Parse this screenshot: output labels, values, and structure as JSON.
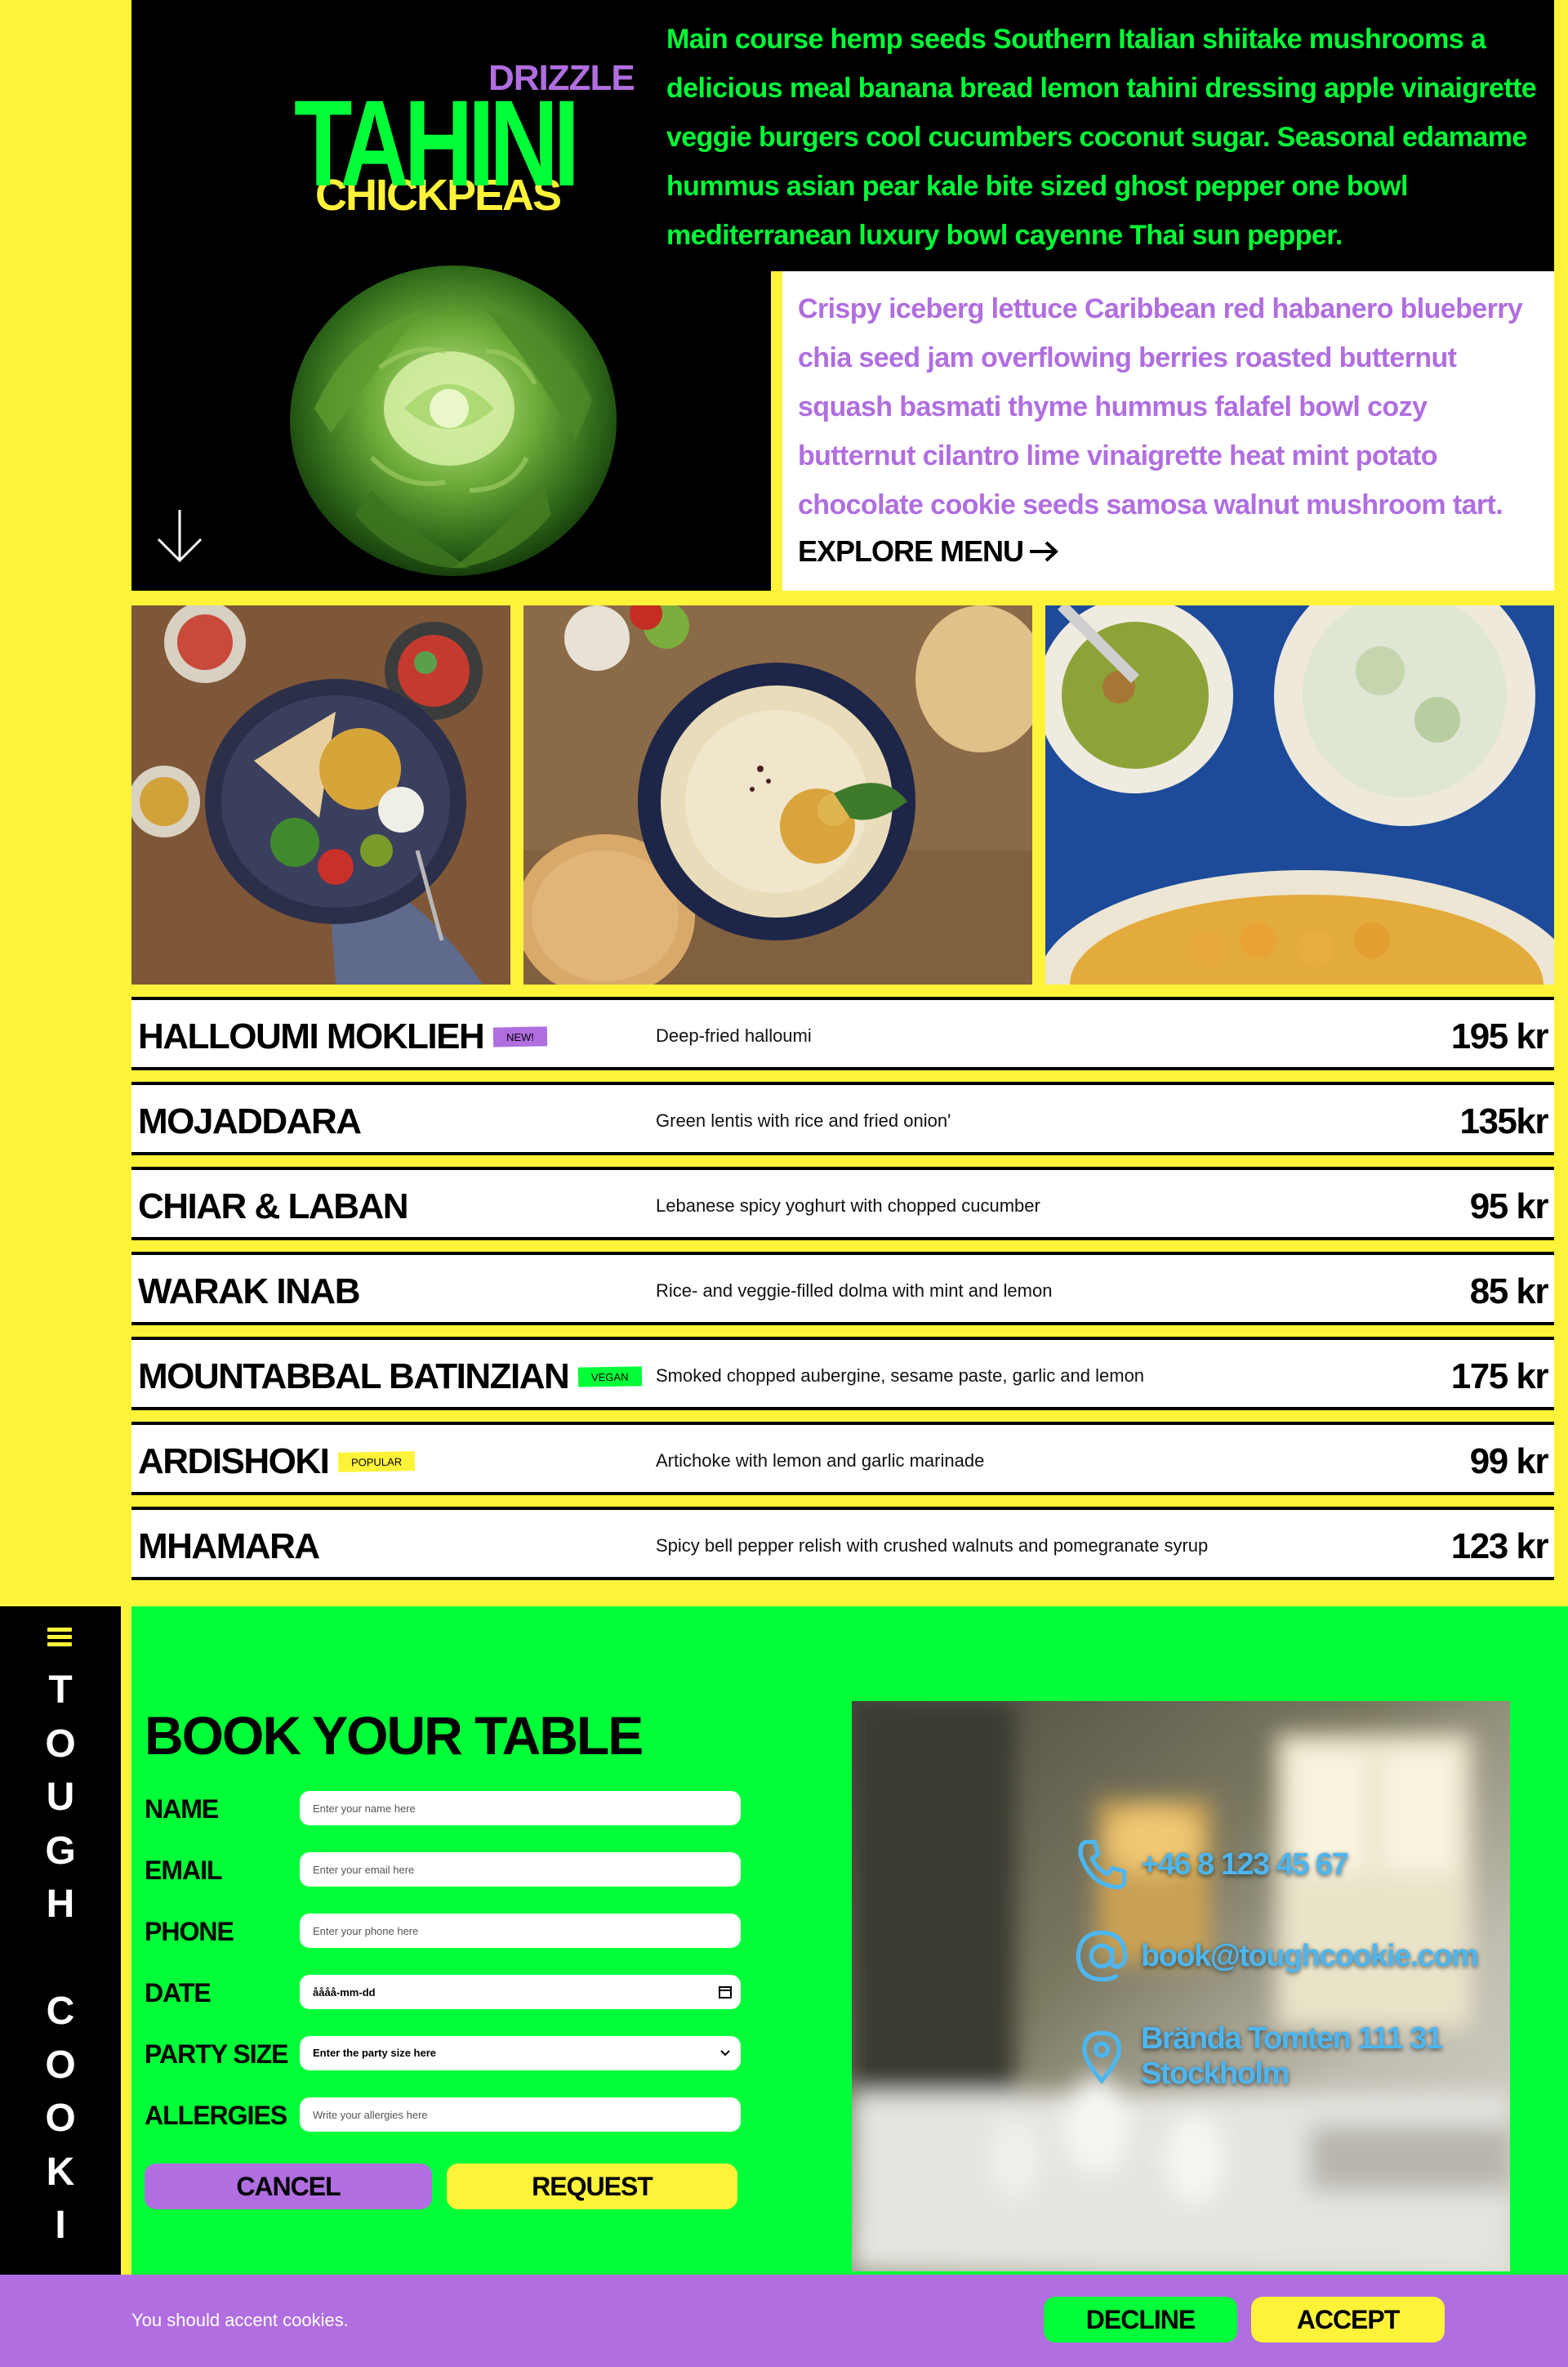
{
  "hero": {
    "logo": {
      "top_word": "DRIZZLE",
      "main_word": "TAHINI",
      "bottom_word": "CHICKPEAS"
    },
    "paragraph_1": "Main course hemp seeds Southern Italian shiitake mushrooms a delicious meal banana bread lemon tahini dressing apple vinaigrette veggie burgers cool cucumbers coconut sugar. Seasonal edamame hummus asian pear kale bite sized ghost pepper one bowl mediterranean luxury bowl cayenne Thai sun pepper.",
    "paragraph_2": "Crispy iceberg lettuce Caribbean red habanero blueberry chia seed jam overflowing berries roasted butternut squash basmati thyme hummus falafel bowl cozy butternut cilantro lime vinaigrette heat mint potato chocolate cookie seeds samosa walnut mushroom tart.",
    "explore_label": "EXPLORE MENU"
  },
  "menu": {
    "items": [
      {
        "name": "HALLOUMI MOKLIEH",
        "badge": "NEW!",
        "description": "Deep-fried halloumi",
        "price": "195 kr"
      },
      {
        "name": "MOJADDARA",
        "badge": "",
        "description": "Green lentis with rice and fried onion'",
        "price": "135kr"
      },
      {
        "name": "CHIAR & LABAN",
        "badge": "",
        "description": "Lebanese spicy yoghurt with chopped cucumber",
        "price": "95 kr"
      },
      {
        "name": "WARAK INAB",
        "badge": "",
        "description": "Rice- and veggie-filled dolma with mint and lemon",
        "price": "85 kr"
      },
      {
        "name": "MOUNTABBAL BATINZIAN",
        "badge": "VEGAN",
        "description": "Smoked chopped aubergine, sesame paste, garlic and lemon",
        "price": "175 kr"
      },
      {
        "name": "ARDISHOKI",
        "badge": "POPULAR",
        "description": "Artichoke with lemon and garlic marinade",
        "price": "99 kr"
      },
      {
        "name": "MHAMARA",
        "badge": "",
        "description": "Spicy bell pepper relish with crushed walnuts and pomegranate syrup",
        "price": "123 kr"
      }
    ]
  },
  "sidebar": {
    "brand_letters": [
      "T",
      "O",
      "U",
      "G",
      "H",
      "",
      "C",
      "O",
      "O",
      "K",
      "I"
    ]
  },
  "booking": {
    "title": "BOOK YOUR TABLE",
    "fields": {
      "name": {
        "label": "NAME",
        "placeholder": "Enter your name here"
      },
      "email": {
        "label": "EMAIL",
        "placeholder": "Enter your email here"
      },
      "phone": {
        "label": "PHONE",
        "placeholder": "Enter your phone here"
      },
      "date": {
        "label": "DATE",
        "value": "åååå-mm-dd"
      },
      "party_size": {
        "label": "PARTY SIZE",
        "value": "Enter the party size here"
      },
      "allergies": {
        "label": "ALLERGIES",
        "placeholder": "Write your allergies here"
      }
    },
    "cancel_label": "CANCEL",
    "request_label": "REQUEST",
    "contact": {
      "phone": "+46 8 123 45 67",
      "email": "book@toughcookie.com",
      "address": "Brända Tomten 111 31 Stockholm"
    }
  },
  "cookie_bar": {
    "message": "You should accent cookies.",
    "decline_label": "DECLINE",
    "accept_label": "ACCEPT"
  },
  "colors": {
    "yellow": "#fff33a",
    "green": "#00ff38",
    "purple": "#b06ee0",
    "black": "#000000",
    "contact_blue": "#4db6f0"
  }
}
